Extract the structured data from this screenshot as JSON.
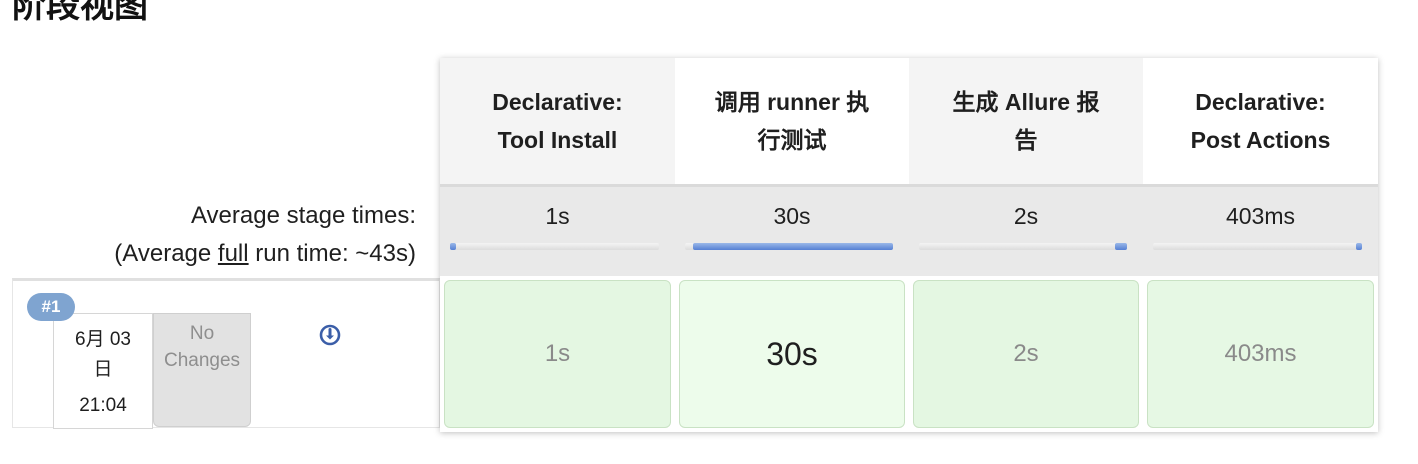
{
  "page_title": "阶段视图",
  "average": {
    "line1": "Average stage times:",
    "line2_prefix": "(Average ",
    "line2_full": "full",
    "line2_suffix": " run time: ~43s)"
  },
  "build": {
    "number": "#1",
    "date_line1": "6月 03",
    "date_line2": "日",
    "time": "21:04",
    "changes_line1": "No",
    "changes_line2": "Changes",
    "icon": "download-circle-icon"
  },
  "stages": [
    {
      "name_line1": "Declarative:",
      "name_line2": "Tool Install",
      "avg": "1s",
      "avg_fraction": 0.03,
      "cell": "1s",
      "cell_color": "#e4f7e2",
      "cell_text_color": "#8a8a8a"
    },
    {
      "name_line1": "调用 runner 执",
      "name_line2": "行测试",
      "avg": "30s",
      "avg_fraction": 0.96,
      "cell": "30s",
      "cell_color": "#edfceb",
      "cell_text_color": "#1f1f1f"
    },
    {
      "name_line1": "生成 Allure 报",
      "name_line2": "告",
      "avg": "2s",
      "avg_fraction": 0.06,
      "cell": "2s",
      "cell_color": "#e4f7e2",
      "cell_text_color": "#8a8a8a"
    },
    {
      "name_line1": "Declarative:",
      "name_line2": "Post Actions",
      "avg": "403ms",
      "avg_fraction": 0.01,
      "cell": "403ms",
      "cell_color": "#e6f8e4",
      "cell_text_color": "#8a8a8a"
    }
  ],
  "colors": {
    "badge": "#7fa4d0",
    "bar": "#5680d4",
    "icon": "#3b5ea8"
  }
}
